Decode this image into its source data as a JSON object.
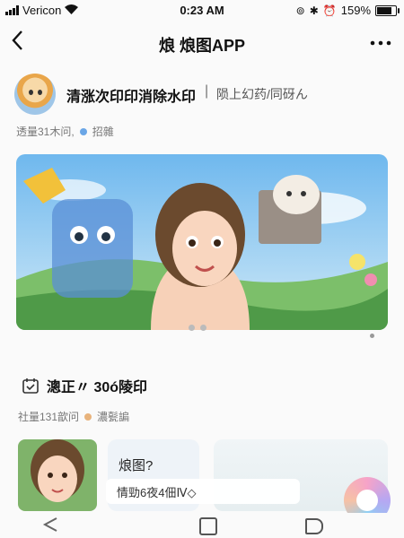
{
  "status_bar": {
    "carrier": "Vericon",
    "time": "0:23 AM",
    "battery_percent": "159%",
    "battery_level": 0.9
  },
  "nav": {
    "title": "烺 烺图APP",
    "back_icon": "back-arrow-icon",
    "more_icon": "more-dots-icon"
  },
  "author": {
    "name": "清涨次印印消除水印",
    "separator": "|",
    "subtitle": "陨上幻药/同砑ん"
  },
  "meta": {
    "stats": "透量31木问,",
    "tag": "招雜",
    "tag_color": "#6aa6e6"
  },
  "section": {
    "title": "漗正〃 30ó陵印",
    "meta": "社量131歆问",
    "tag": "濃甏諞",
    "tag_color": "#e8b37c"
  },
  "cards": {
    "card_2_title": "烺图?"
  },
  "tooltip": {
    "text": "情勁6夜4佃Ⅳ◇"
  }
}
